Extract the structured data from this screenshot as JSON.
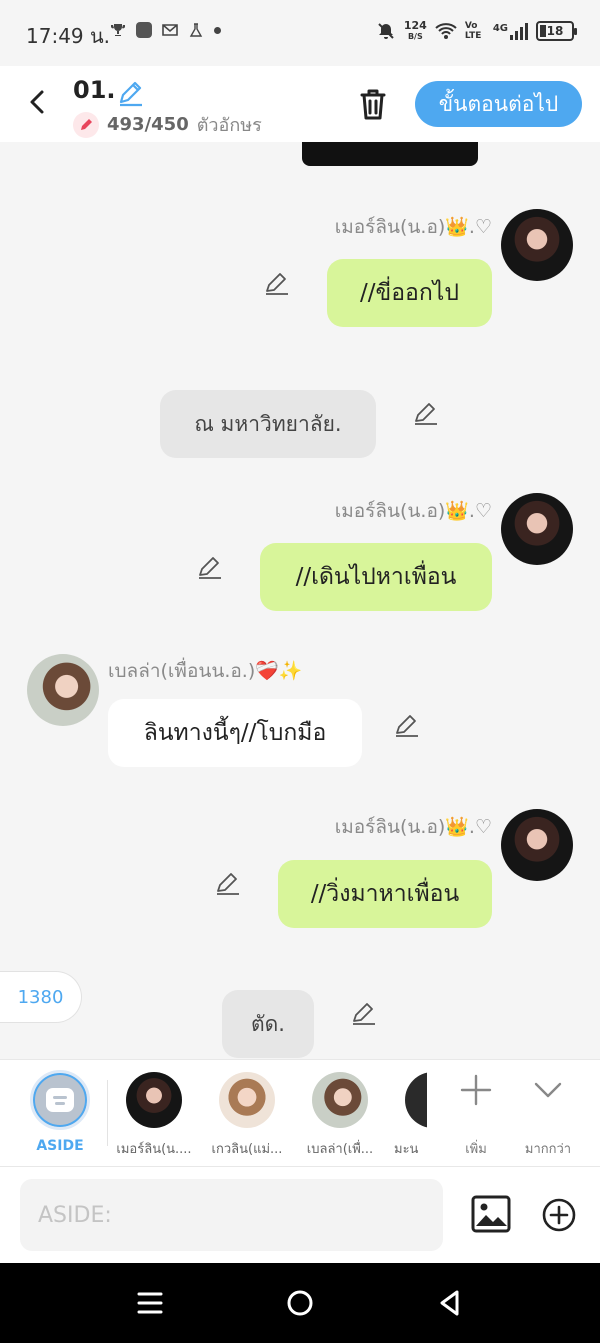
{
  "status_bar": {
    "time": "17:49 น.",
    "net_speed": "124",
    "net_unit": "B/S",
    "volte": "Vo LTE",
    "signal": "4G",
    "battery": "18"
  },
  "header": {
    "title": "01.",
    "char_count": "493/450",
    "char_unit": "ตัวอักษร",
    "next_label": "ขั้นตอนต่อไป"
  },
  "messages": [
    {
      "type": "sent",
      "sender": "เมอร์ลิน(น.อ)👑.♡",
      "text": "//ขี่ออกไป"
    },
    {
      "type": "narration",
      "text": "ณ มหาวิทยาลัย."
    },
    {
      "type": "sent",
      "sender": "เมอร์ลิน(น.อ)👑.♡",
      "text": "//เดินไปหาเพื่อน"
    },
    {
      "type": "received",
      "sender": "เบลล่า(เพื่อนน.อ.)❤️‍🩹✨",
      "text": "ลินทางนี้ๆ//โบกมือ"
    },
    {
      "type": "sent",
      "sender": "เมอร์ลิน(น.อ)👑.♡",
      "text": "//วิ่งมาหาเพื่อน"
    },
    {
      "type": "narration",
      "text": "ตัด."
    }
  ],
  "count_pill": "1380",
  "character_bar": {
    "aside_label": "ASIDE",
    "characters": [
      {
        "label": "เมอร์ลิน(น...."
      },
      {
        "label": "เกวลิน(แม่..."
      },
      {
        "label": "เบลล่า(เพื่..."
      },
      {
        "label": "มะน"
      }
    ],
    "add_label": "เพิ่ม",
    "more_label": "มากกว่า"
  },
  "input": {
    "placeholder": "ASIDE:"
  }
}
